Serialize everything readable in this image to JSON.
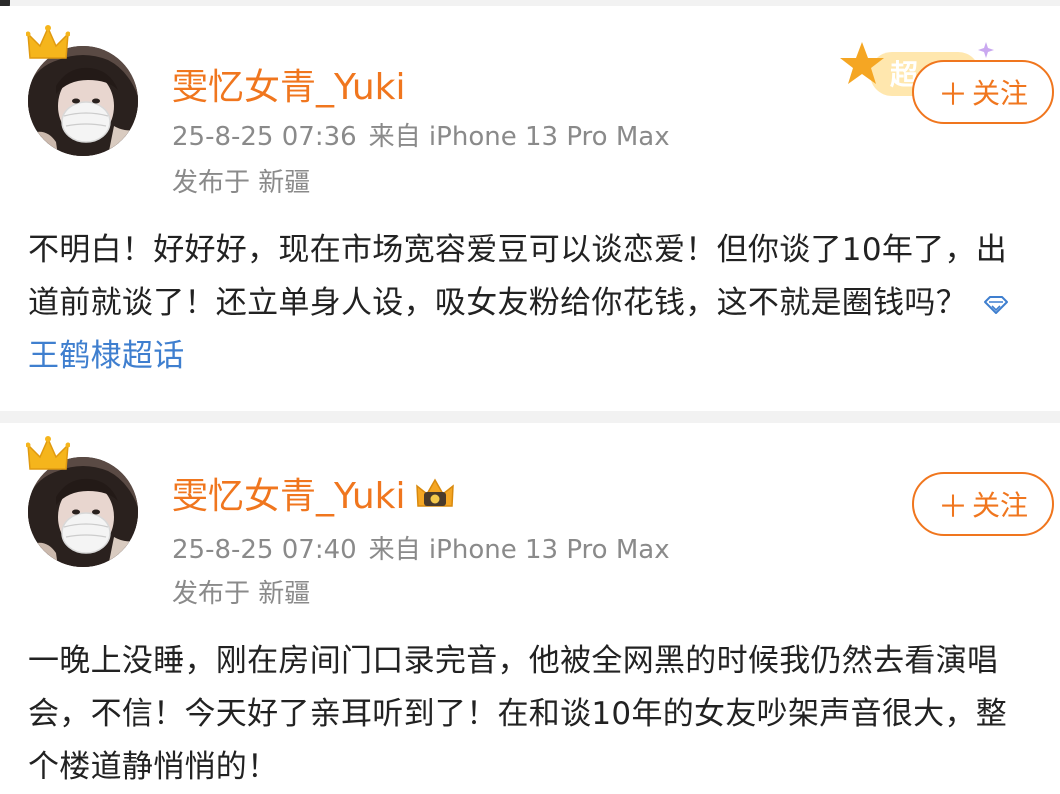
{
  "posts": [
    {
      "username": "雯忆女青_Yuki",
      "timestamp": "25-8-25 07:36",
      "source": "来自 iPhone 13 Pro Max",
      "location": "发布于 新疆",
      "follow_label": "关注",
      "super_badge_text": "超",
      "text": "不明白！好好好，现在市场宽容爱豆可以谈恋爱！但你谈了10年了，出道前就谈了！还立单身人设，吸女友粉给你花钱，这不就是圈钱吗？",
      "topic": "王鹤棣超话"
    },
    {
      "username": "雯忆女青_Yuki",
      "timestamp": "25-8-25 07:40",
      "source": "来自 iPhone 13 Pro Max",
      "location": "发布于 新疆",
      "follow_label": "关注",
      "text": "一晚上没睡，刚在房间门口录完音，他被全网黑的时候我仍然去看演唱会，不信！今天好了亲耳听到了！在和谈10年的女友吵架声音很大，整个楼道静悄悄的！"
    }
  ],
  "colors": {
    "accent": "#f0761e",
    "link": "#3f7fcf",
    "meta": "#8a8a8a",
    "text": "#222222"
  }
}
